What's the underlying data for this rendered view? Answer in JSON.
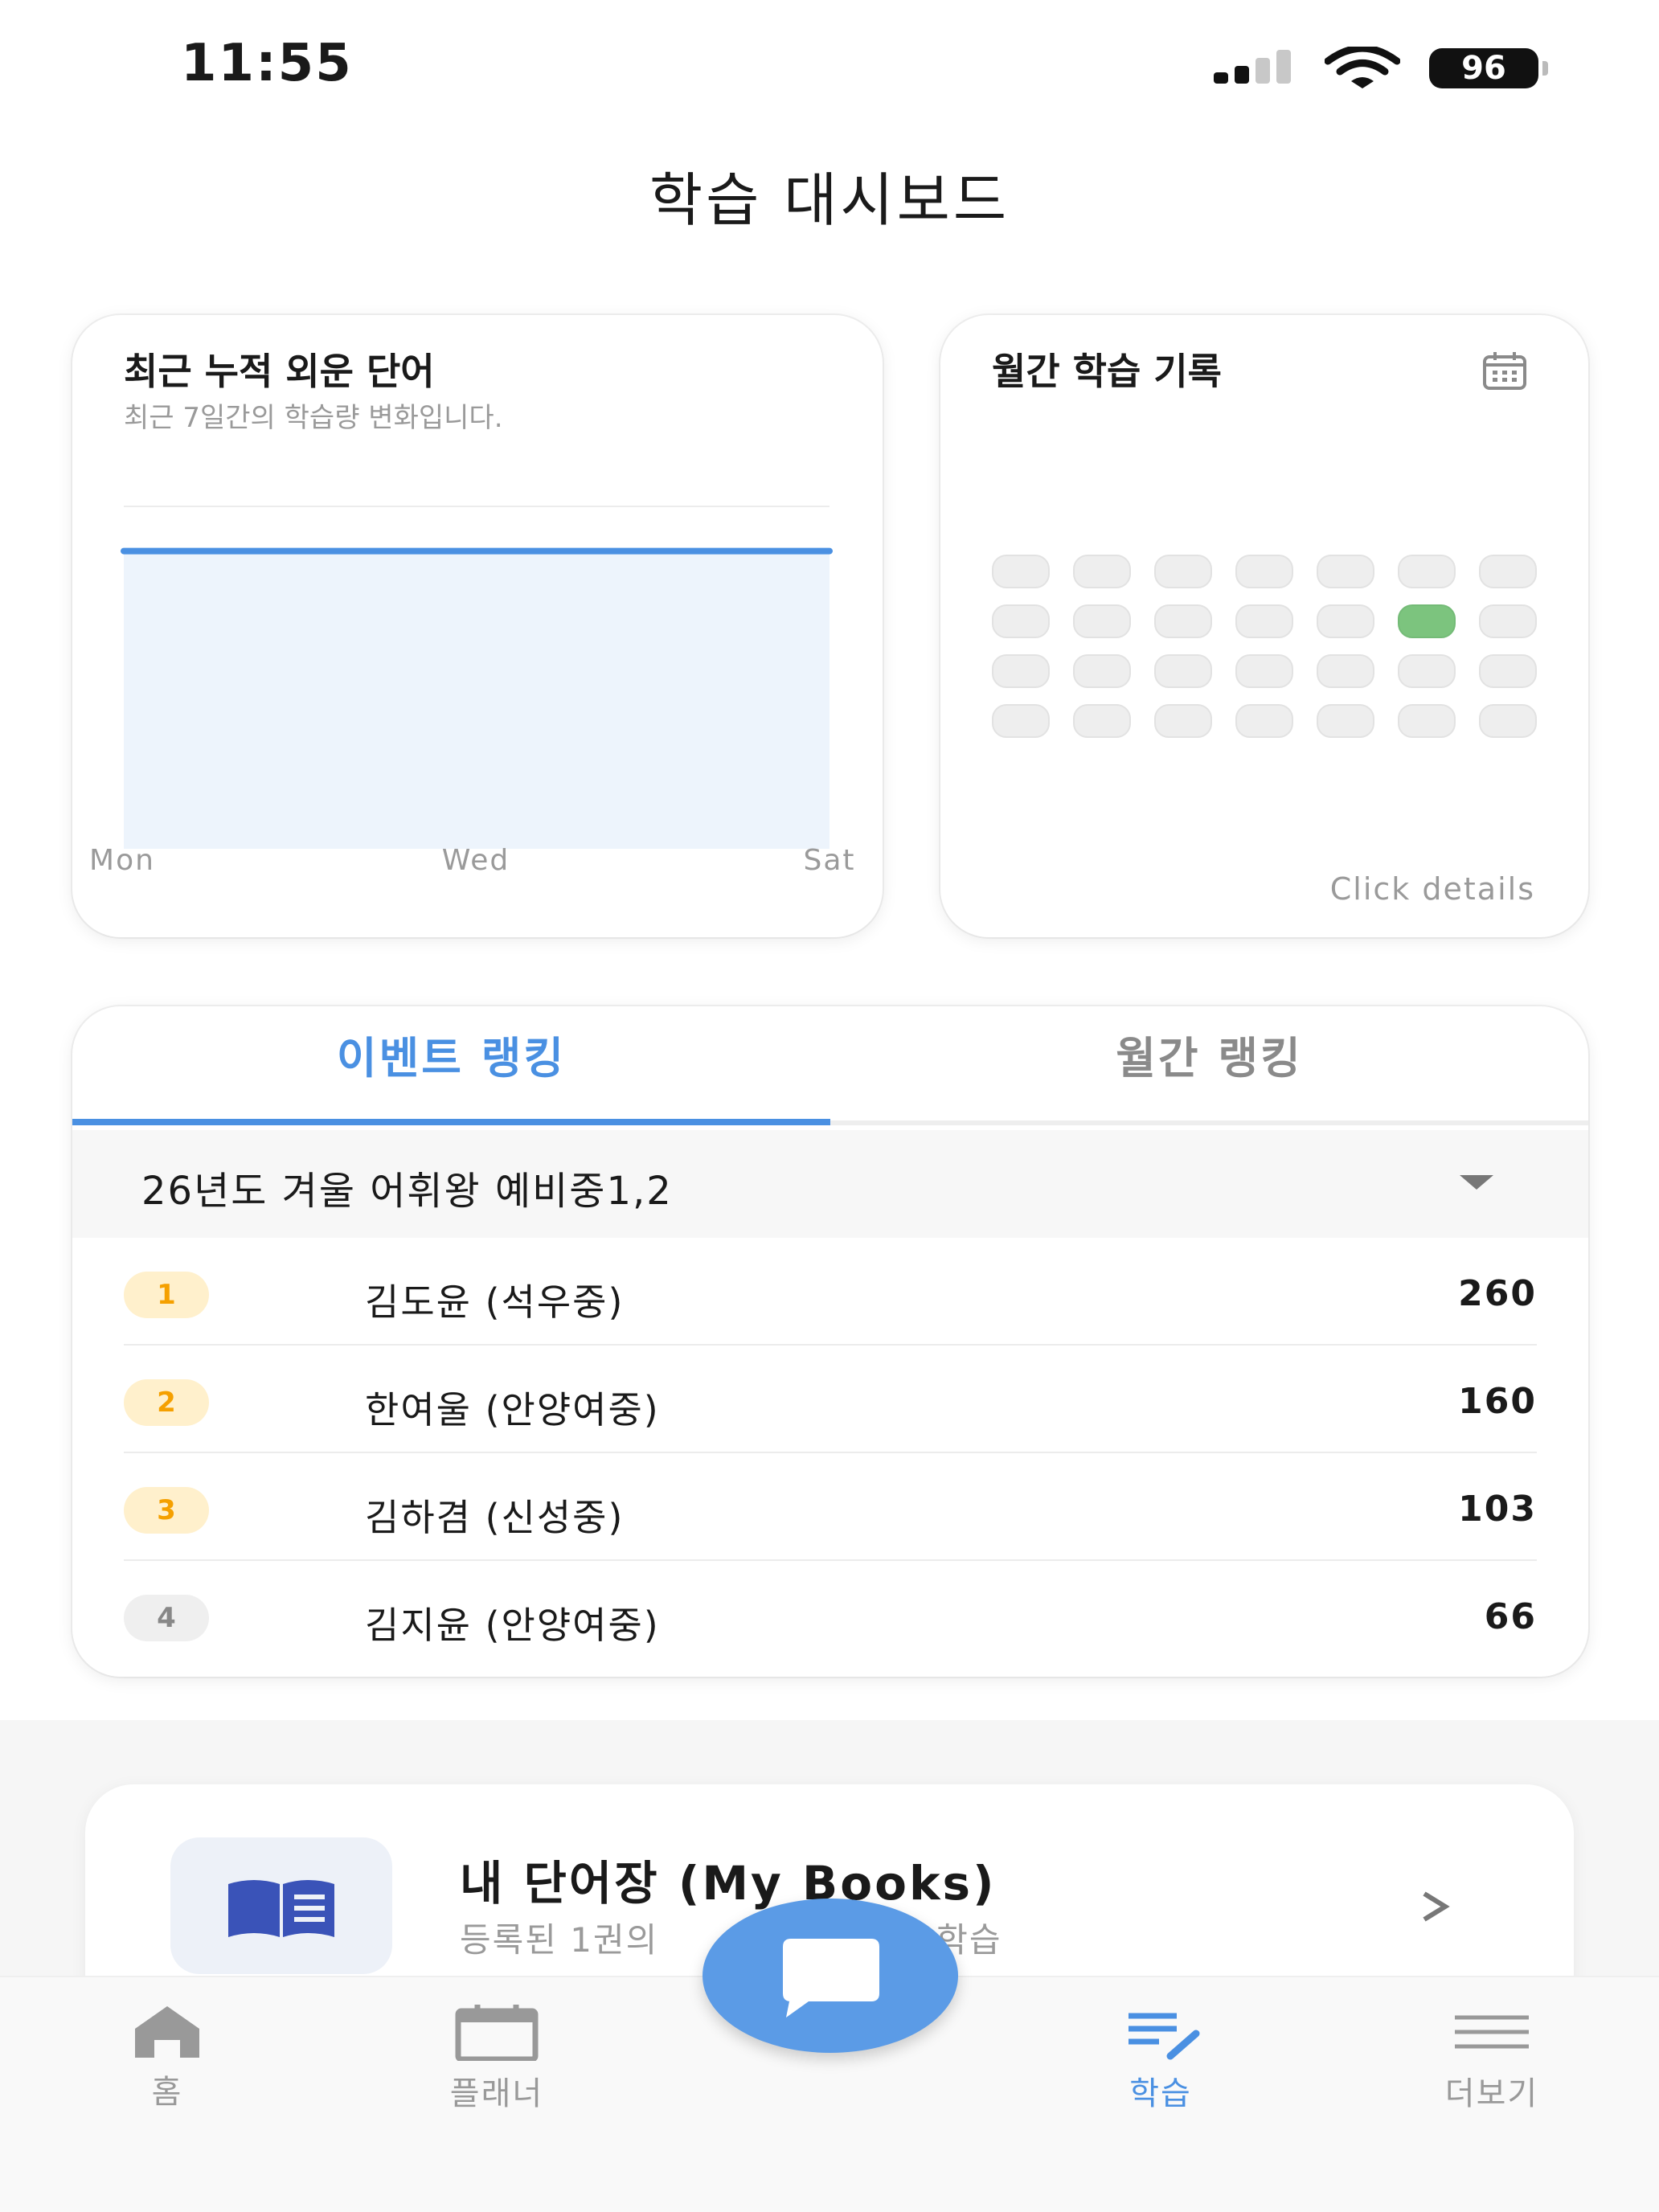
{
  "status_bar": {
    "time": "11:55",
    "battery": "96"
  },
  "header": {
    "title": "학습 대시보드"
  },
  "chart_card": {
    "title": "최근 누적 외운 단어",
    "subtitle": "최근 7일간의 학습량 변화입니다."
  },
  "chart_data": {
    "type": "area",
    "x": [
      "Mon",
      "Wed",
      "Sat"
    ],
    "series": [
      {
        "values": [
          1,
          1,
          1
        ]
      }
    ],
    "color": "#4a90e2",
    "fill": "#edf4fc",
    "grid": true
  },
  "calendar_card": {
    "title": "월간 학습 기록",
    "icon": "calendar-icon",
    "rows": 4,
    "cols": 7,
    "active_cells": [
      [
        1,
        5
      ]
    ],
    "active_color": "#7cc47e",
    "footer": "Click details"
  },
  "ranking": {
    "tabs": [
      {
        "label": "이벤트 랭킹",
        "active": true
      },
      {
        "label": "월간 랭킹",
        "active": false
      }
    ],
    "selected_event": "26년도 겨울 어휘왕 예비중1,2",
    "rows": [
      {
        "rank": "1",
        "name": "김도윤 (석우중)",
        "score": "260"
      },
      {
        "rank": "2",
        "name": "한여울 (안양여중)",
        "score": "160"
      },
      {
        "rank": "3",
        "name": "김하겸 (신성중)",
        "score": "103"
      },
      {
        "rank": "4",
        "name": "김지윤 (안양여중)",
        "score": "66"
      }
    ]
  },
  "books": {
    "title": "내 단어장 (My Books)",
    "subtitle_left": "등록된 1권의",
    "subtitle_right": "로 학습",
    "icon": "book-icon"
  },
  "nav": {
    "items": [
      {
        "label": "홈",
        "icon": "home-icon",
        "active": false
      },
      {
        "label": "플래너",
        "icon": "calendar-icon",
        "active": false
      },
      {
        "label": "학습",
        "icon": "study-edit-icon",
        "active": true
      },
      {
        "label": "더보기",
        "icon": "menu-icon",
        "active": false
      }
    ],
    "fab_icon": "chat-icon"
  },
  "colors": {
    "accent": "#4a90e2",
    "rank_top": "#f5a000",
    "fab": "#5b9be6"
  }
}
